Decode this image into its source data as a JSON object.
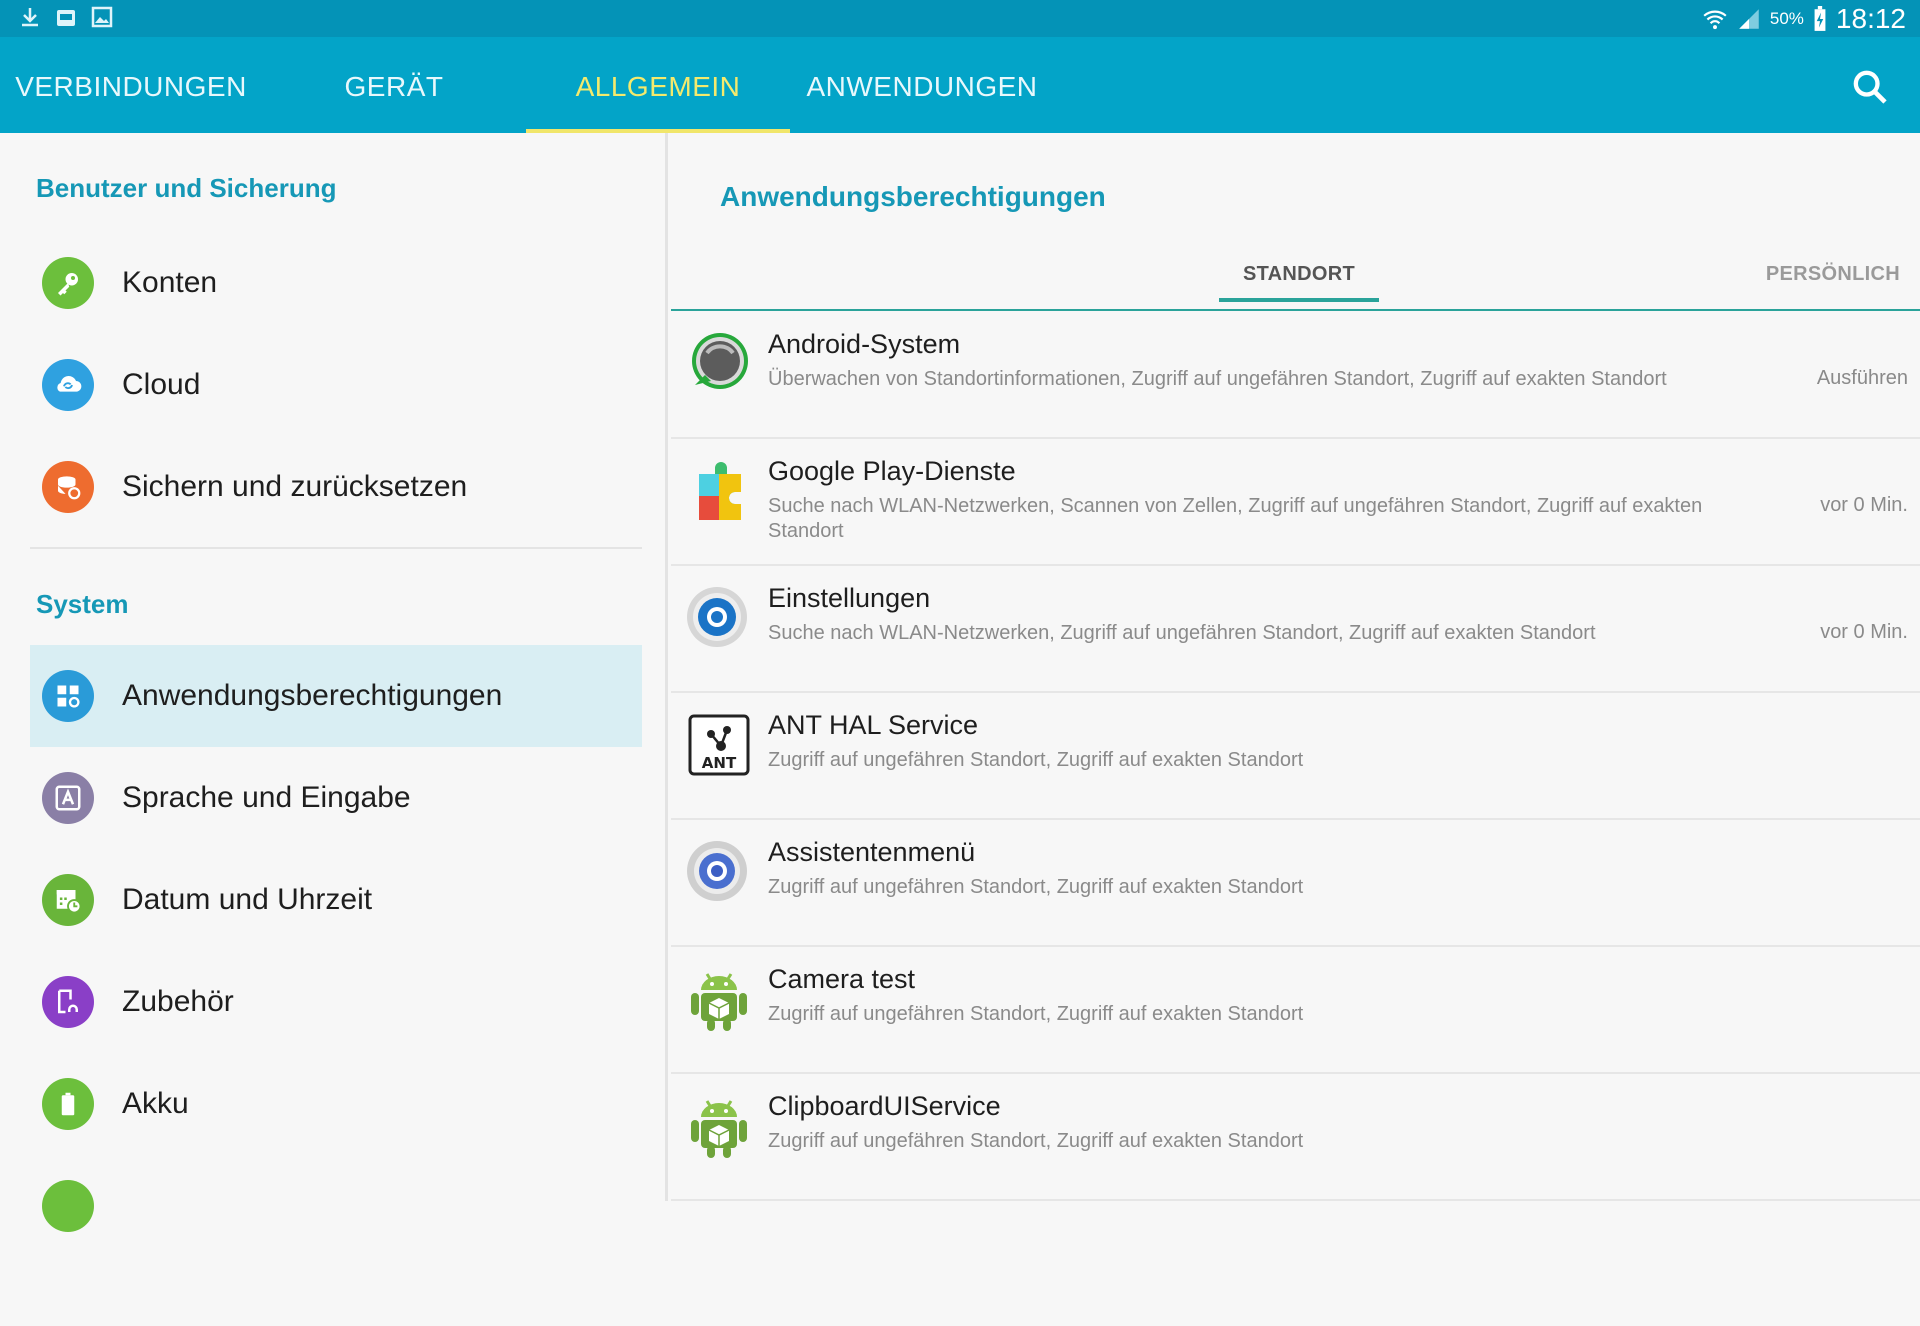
{
  "statusbar": {
    "battery": "50%",
    "time": "18:12"
  },
  "tabs": [
    {
      "label": "VERBINDUNGEN"
    },
    {
      "label": "GERÄT"
    },
    {
      "label": "ALLGEMEIN"
    },
    {
      "label": "ANWENDUNGEN"
    }
  ],
  "left": {
    "section1": "Benutzer und Sicherung",
    "section2": "System",
    "items": [
      {
        "label": "Konten",
        "color": "#6cbf3c"
      },
      {
        "label": "Cloud",
        "color": "#2fa1e0"
      },
      {
        "label": "Sichern und zurücksetzen",
        "color": "#ee6c2f"
      },
      {
        "label": "Anwendungsberechtigungen",
        "color": "#2a9bd8"
      },
      {
        "label": "Sprache und Eingabe",
        "color": "#8a7fa6"
      },
      {
        "label": "Datum und Uhrzeit",
        "color": "#69b53a"
      },
      {
        "label": "Zubehör",
        "color": "#8a3fc7"
      },
      {
        "label": "Akku",
        "color": "#6cbf3c"
      }
    ]
  },
  "right": {
    "title": "Anwendungsberechtigungen",
    "subtabs": [
      "STANDORT",
      "PERSÖNLICH"
    ],
    "apps": [
      {
        "name": "Android-System",
        "desc": "Überwachen von Standortinformationen, Zugriff auf ungefähren Standort, Zugriff auf exakten Standort",
        "time": "Ausführen",
        "icon": "android-system-icon"
      },
      {
        "name": "Google Play-Dienste",
        "desc": "Suche nach WLAN-Netzwerken, Scannen von Zellen, Zugriff auf ungefähren Standort, Zugriff auf exakten Standort",
        "time": "vor 0 Min.",
        "icon": "google-play-services-icon"
      },
      {
        "name": "Einstellungen",
        "desc": "Suche nach WLAN-Netzwerken, Zugriff auf ungefähren Standort, Zugriff auf exakten Standort",
        "time": "vor 0 Min.",
        "icon": "settings-gear-icon"
      },
      {
        "name": "ANT HAL Service",
        "desc": "Zugriff auf ungefähren Standort, Zugriff auf exakten Standort",
        "time": "",
        "icon": "ant-icon"
      },
      {
        "name": "Assistentenmenü",
        "desc": "Zugriff auf ungefähren Standort, Zugriff auf exakten Standort",
        "time": "",
        "icon": "assistant-gear-icon"
      },
      {
        "name": "Camera test",
        "desc": "Zugriff auf ungefähren Standort, Zugriff auf exakten Standort",
        "time": "",
        "icon": "android-robot-icon"
      },
      {
        "name": "ClipboardUIService",
        "desc": "Zugriff auf ungefähren Standort, Zugriff auf exakten Standort",
        "time": "",
        "icon": "android-robot-icon"
      }
    ]
  },
  "colors": {
    "statusbar": "#0493b7",
    "tabbar": "#03a4c8",
    "active_tab": "#f4ea6d",
    "section_title": "#1698b6",
    "accent": "#2aa39a"
  }
}
